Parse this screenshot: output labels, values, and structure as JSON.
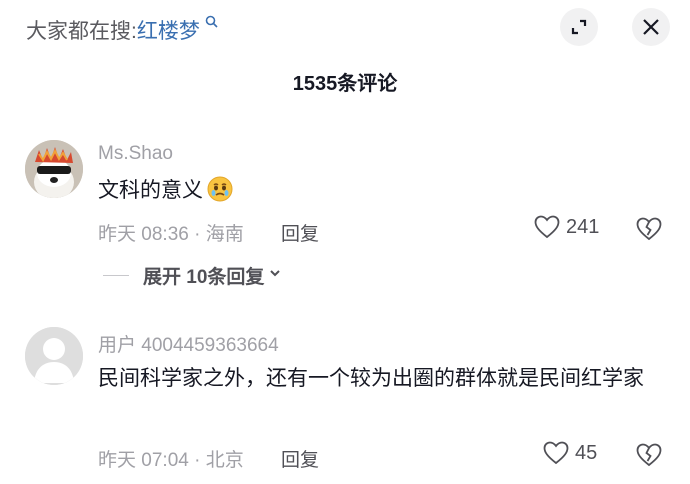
{
  "top": {
    "search_label": "大家都在搜:",
    "search_keyword": "红楼梦",
    "comment_count": "1535条评论"
  },
  "comments": [
    {
      "username": "Ms.Shao",
      "text": "文科的意义",
      "emoji": "crying-face-emoji",
      "meta": "昨天 08:36 · 海南",
      "reply_label": "回复",
      "likes": "241",
      "expand_label": "展开 10条回复"
    },
    {
      "username": "用户 4004459363664",
      "text": "民间科学家之外，还有一个较为出圈的群体就是民间红学家",
      "meta": "昨天 07:04 · 北京",
      "reply_label": "回复",
      "likes": "45"
    }
  ],
  "colors": {
    "keyword": "#3a6fb0",
    "muted": "#a0a0a6",
    "text": "#161823"
  }
}
